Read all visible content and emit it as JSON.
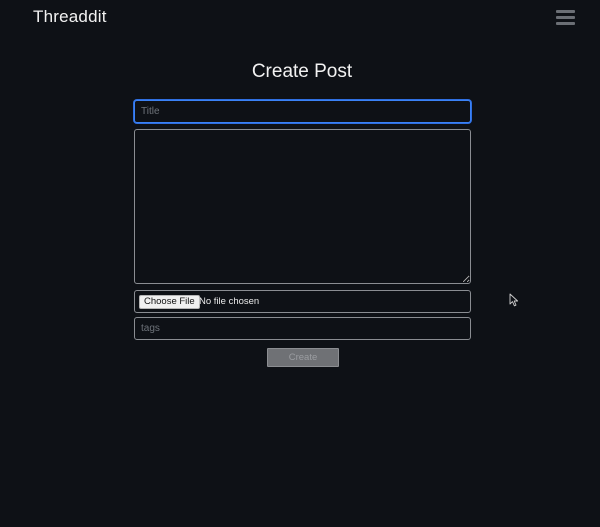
{
  "app": {
    "title": "Threaddit",
    "menu_icon": "hamburger-menu-icon"
  },
  "form": {
    "heading": "Create Post",
    "title_placeholder": "Title",
    "title_value": "",
    "body_value": "",
    "file_button_label": "Choose File",
    "file_status": "No file chosen",
    "tags_placeholder": "tags",
    "submit_label": "Create"
  },
  "colors": {
    "background": "#0e1116",
    "focus_border": "#3b82f6",
    "field_border": "#8a8d92",
    "disabled_button": "#6f7175"
  }
}
